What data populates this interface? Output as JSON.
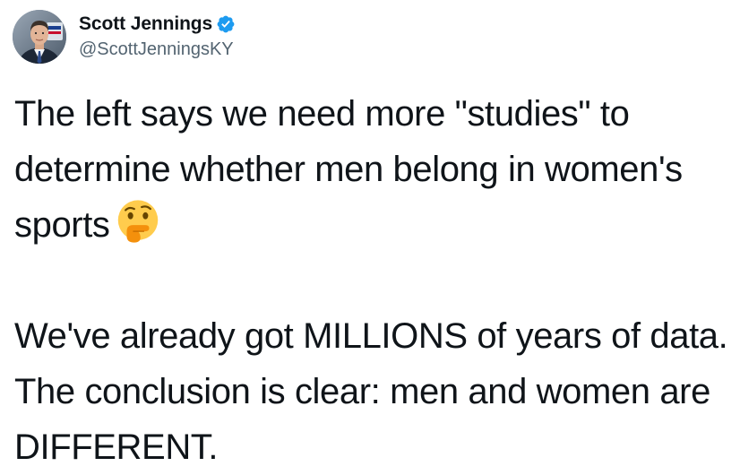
{
  "author": {
    "display_name": "Scott Jennings",
    "handle": "@ScottJenningsKY",
    "verified": true,
    "verified_color": "#1d9bf0",
    "avatar_icon": "profile-photo-avatar"
  },
  "tweet": {
    "paragraph1_text": "The left says we need more \"studies\" to determine whether men belong in women's sports",
    "paragraph1_emoji": "thinking-face-emoji",
    "paragraph2_text": "We've already got MILLIONS of years of data. The conclusion is clear: men and women are DIFFERENT."
  },
  "colors": {
    "text": "#0f1419",
    "secondary_text": "#536471",
    "background": "#ffffff"
  }
}
